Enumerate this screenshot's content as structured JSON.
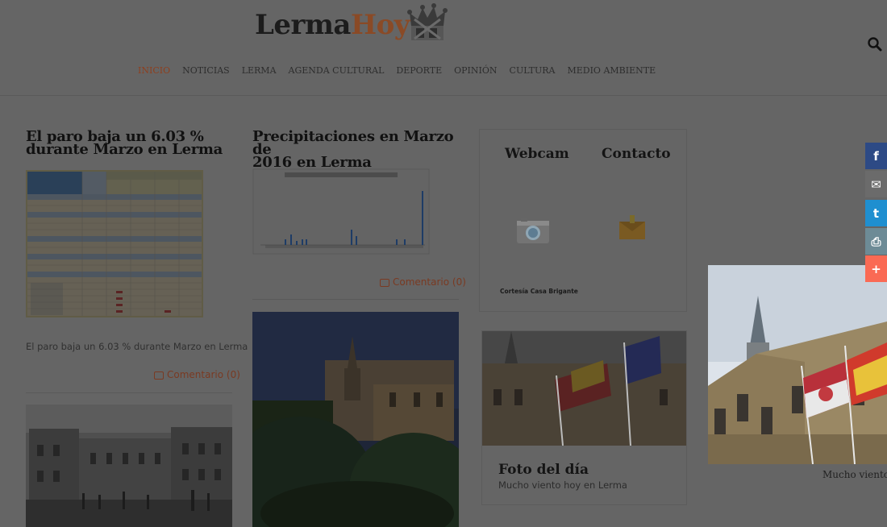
{
  "header": {
    "logo_part1": "Lerma",
    "logo_part2": "Hoy",
    "nav": [
      "INICIO",
      "NOTICIAS",
      "LERMA",
      "AGENDA CULTURAL",
      "DEPORTE",
      "OPINIÓN",
      "CULTURA",
      "MEDIO AMBIENTE"
    ],
    "active_nav": "INICIO"
  },
  "articles": [
    {
      "title_line1": "El paro baja un 6.03 %",
      "title_line2": "durante Marzo en Lerma",
      "excerpt": "El paro baja un 6.03 % durante Marzo en Lerma",
      "comments": "Comentario (0)"
    },
    {
      "title_line1": "Precipitaciones en Marzo de",
      "title_line2": "2016 en Lerma",
      "comments": "Comentario (0)"
    }
  ],
  "widget": {
    "tab_webcam": "Webcam",
    "tab_contacto": "Contacto",
    "credit": "Cortesía Casa Brigante"
  },
  "foto_del_dia": {
    "title": "Foto del día",
    "caption": "Mucho viento hoy en Lerma"
  },
  "lightbox": {
    "caption": "Mucho viento"
  },
  "share": [
    {
      "icon": "facebook-icon",
      "glyph": "f",
      "color": "#2d4a85"
    },
    {
      "icon": "email-icon",
      "glyph": "✉",
      "color": "#6b6b6b"
    },
    {
      "icon": "twitter-icon",
      "glyph": "t",
      "color": "#1f8fd0"
    },
    {
      "icon": "print-icon",
      "glyph": "⎙",
      "color": "#6d8b96"
    },
    {
      "icon": "more-icon",
      "glyph": "+",
      "color": "#fa6a54"
    }
  ],
  "colors": {
    "overlay_bg": "#656565",
    "accent": "#8e3f1e"
  }
}
